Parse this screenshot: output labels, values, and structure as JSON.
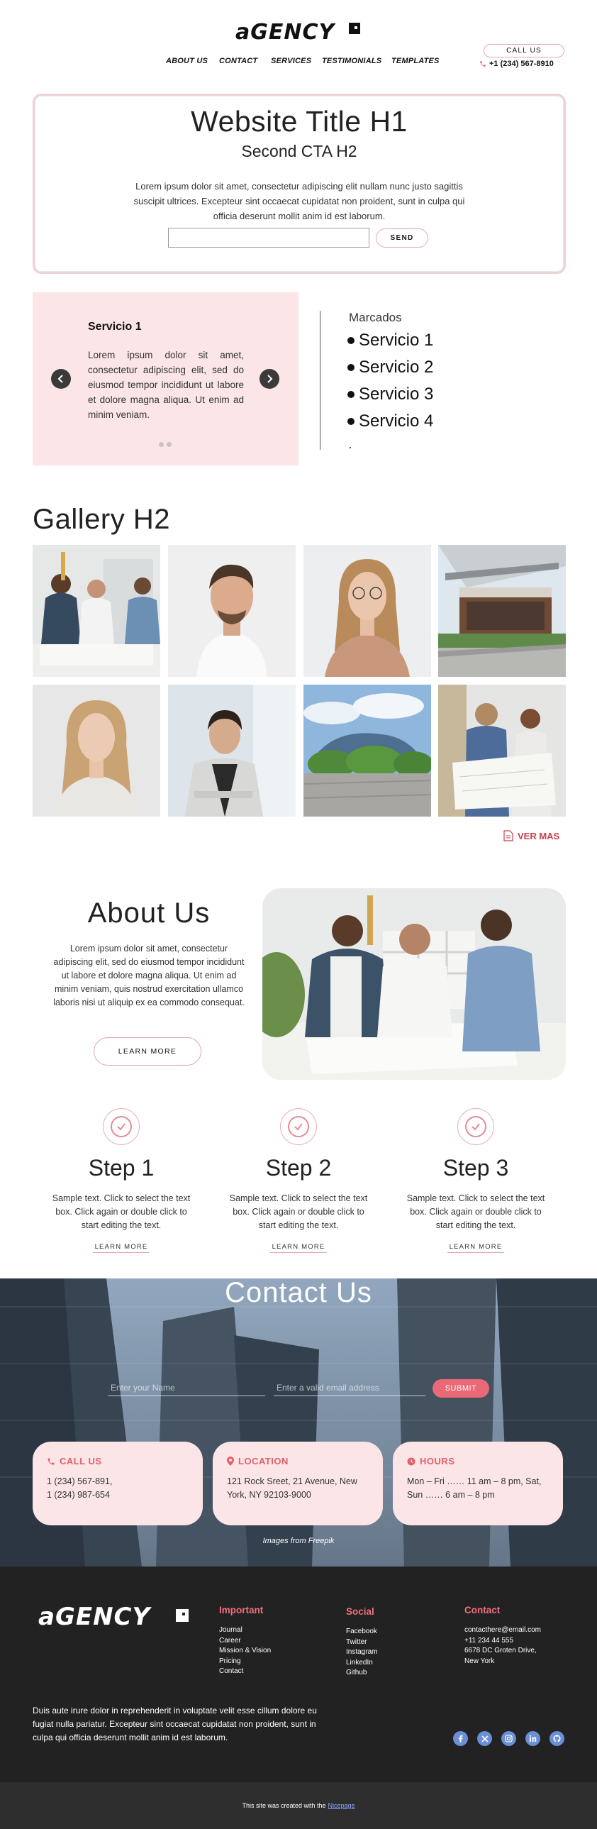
{
  "header": {
    "logo_text": "aGENCY",
    "nav": [
      "ABOUT US",
      "CONTACT",
      "SERVICES",
      "TESTIMONIALS",
      "TEMPLATES"
    ],
    "call_label": "CALL US",
    "phone": "+1 (234) 567-8910"
  },
  "hero": {
    "title": "Website Title H1",
    "subtitle": "Second CTA H2",
    "text": "Lorem ipsum dolor sit amet, consectetur adipiscing elit nullam nunc justo sagittis suscipit ultrices. Excepteur sint occaecat cupidatat non proident, sunt in culpa qui officia deserunt mollit anim id est laborum.",
    "input_value": "",
    "send_label": "SEND"
  },
  "slider": {
    "title": "Servicio 1",
    "text": "Lorem ipsum dolor sit amet, consectetur adipiscing elit, sed do eiusmod tempor incididunt ut labore et dolore magna aliqua. Ut enim ad minim veniam."
  },
  "services": {
    "heading": "Marcados",
    "items": [
      "Servicio 1",
      "Servicio 2",
      "Servicio 3",
      "Servicio 4"
    ]
  },
  "gallery": {
    "title": "Gallery H2",
    "more_label": "VER MAS"
  },
  "about": {
    "title": "About Us",
    "text": "Lorem ipsum dolor sit amet, consectetur adipiscing elit, sed do eiusmod tempor incididunt ut labore et dolore magna aliqua. Ut enim ad minim veniam, quis nostrud exercitation ullamco laboris nisi ut aliquip ex ea commodo consequat.",
    "button": "LEARN MORE"
  },
  "steps": [
    {
      "title": "Step 1",
      "text": "Sample text. Click to select the text box. Click again or double click to start editing the text.",
      "link": "LEARN MORE"
    },
    {
      "title": "Step 2",
      "text": "Sample text. Click to select the text box. Click again or double click to start editing the text.",
      "link": "LEARN MORE"
    },
    {
      "title": "Step 3",
      "text": "Sample text. Click to select the text box. Click again or double click to start editing the text.",
      "link": "LEARN MORE"
    }
  ],
  "contact": {
    "title": "Contact Us",
    "name_placeholder": "Enter your Name",
    "email_placeholder": "Enter a valid email address",
    "submit": "SUBMIT",
    "cards": [
      {
        "title": "CALL US",
        "lines": [
          "1 (234) 567-891,",
          "1 (234) 987-654"
        ]
      },
      {
        "title": "LOCATION",
        "lines": [
          "121 Rock Sreet, 21 Avenue, New",
          "York, NY 92103-9000"
        ]
      },
      {
        "title": "HOURS",
        "lines": [
          "Mon – Fri …… 11 am – 8 pm, Sat,",
          "Sun …… 6 am – 8 pm"
        ]
      }
    ],
    "credit": "Images from Freepik"
  },
  "footer": {
    "logo_text": "aGENCY",
    "cols": [
      {
        "title": "Important",
        "items": [
          "Journal",
          "Career",
          "Mission & Vision",
          "Pricing",
          "Contact"
        ]
      },
      {
        "title": "Social",
        "items": [
          "Facebook",
          "Twitter",
          "Instagram",
          "LinkedIn",
          "Github"
        ]
      },
      {
        "title": "Contact",
        "items": [
          "contacthere@email.com",
          "+11 234 44 555",
          "6678 DC Groten Drive,",
          "New York"
        ]
      }
    ],
    "paragraph": "Duis aute irure dolor in reprehenderit in voluptate velit esse cillum dolore eu fugiat nulla pariatur. Excepteur sint occaecat cupidatat non proident, sunt in culpa qui officia deserunt mollit anim id est laborum.",
    "social_icons": [
      "facebook-icon",
      "x-icon",
      "instagram-icon",
      "linkedin-icon",
      "github-icon"
    ],
    "created_text": "This site was created with the",
    "created_link": "Nicepage"
  },
  "colors": {
    "accent": "#e96a76",
    "pink_bg": "#fbe5e6",
    "footer_bg": "#222222"
  }
}
